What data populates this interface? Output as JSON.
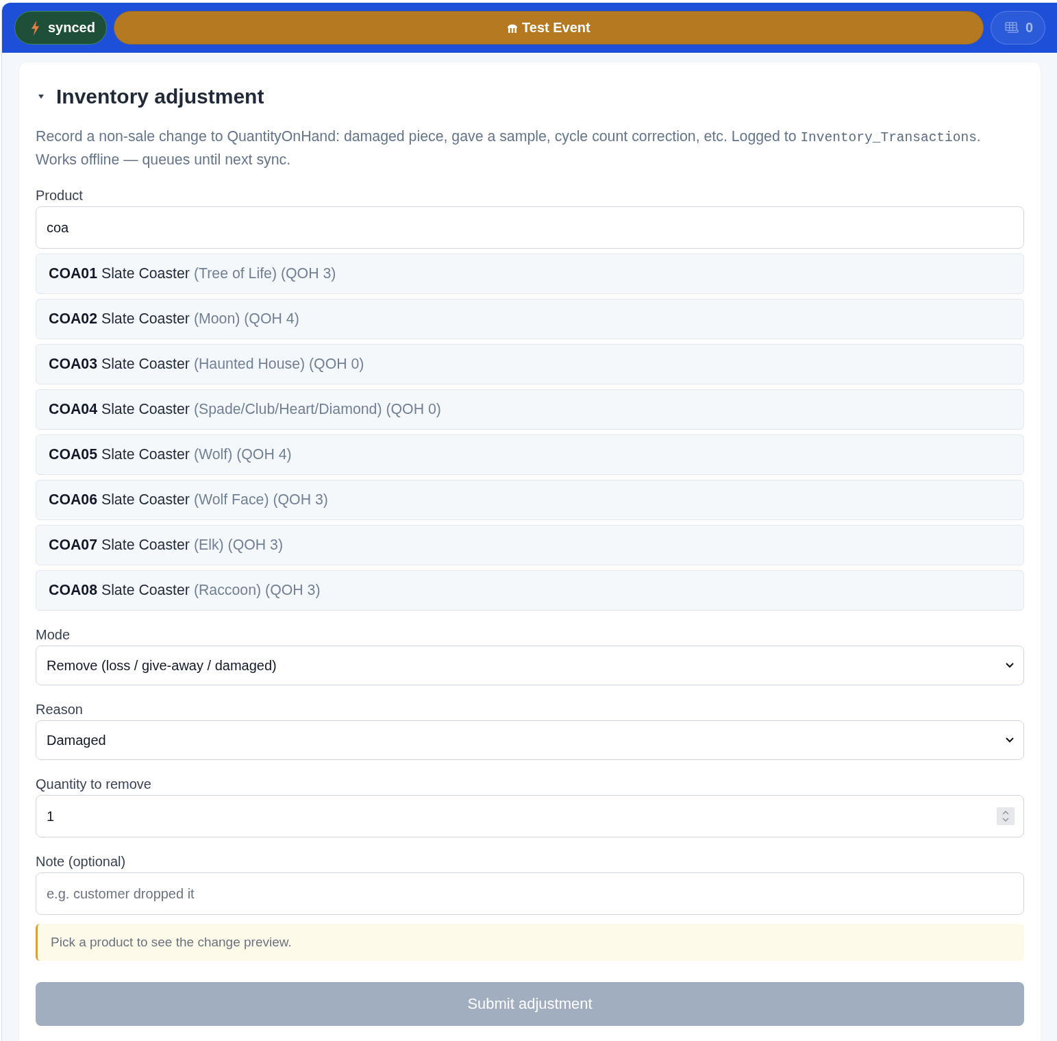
{
  "top_bar": {
    "sync_status": {
      "label": "synced"
    },
    "event": {
      "label": "Test Event"
    },
    "queue": {
      "count": "0"
    }
  },
  "section": {
    "title": "Inventory adjustment",
    "expanded": true,
    "description": [
      {
        "kind": "text",
        "text": "Record a non-sale change to QuantityOnHand: damaged piece, gave a sample, cycle count correction, etc. Logged to "
      },
      {
        "kind": "code",
        "text": "Inventory_Transactions"
      },
      {
        "kind": "text",
        "text": ". Works offline — queues until next sync."
      }
    ],
    "fields": [
      {
        "kind": "text",
        "label": "Product",
        "value": "coa",
        "suggestions": [
          {
            "code": "COA01",
            "name": "Slate Coaster",
            "detail": "(Tree of Life) (QOH 3)",
            "selected": false
          },
          {
            "code": "COA02",
            "name": "Slate Coaster",
            "detail": "(Moon) (QOH 4)",
            "selected": false
          },
          {
            "code": "COA03",
            "name": "Slate Coaster",
            "detail": "(Haunted House) (QOH 0)",
            "selected": false
          },
          {
            "code": "COA04",
            "name": "Slate Coaster",
            "detail": "(Spade/Club/Heart/Diamond) (QOH 0)",
            "selected": false
          },
          {
            "code": "COA05",
            "name": "Slate Coaster",
            "detail": "(Wolf) (QOH 4)",
            "selected": false
          },
          {
            "code": "COA06",
            "name": "Slate Coaster",
            "detail": "(Wolf Face) (QOH 3)",
            "selected": false
          },
          {
            "code": "COA07",
            "name": "Slate Coaster",
            "detail": "(Elk) (QOH 3)",
            "selected": false
          },
          {
            "code": "COA08",
            "name": "Slate Coaster",
            "detail": "(Raccoon) (QOH 3)",
            "selected": false
          }
        ]
      },
      {
        "kind": "select",
        "label": "Mode",
        "value": "Remove (loss / give-away / damaged)"
      },
      {
        "kind": "select",
        "label": "Reason",
        "value": "Damaged"
      },
      {
        "kind": "number",
        "label": "Quantity to remove",
        "value": "1"
      },
      {
        "kind": "text",
        "label": "Note (optional)",
        "placeholder": "e.g. customer dropped it"
      }
    ],
    "preview_hint": "Pick a product to see the change preview.",
    "submit": {
      "label": "Submit adjustment",
      "disabled": true
    }
  }
}
